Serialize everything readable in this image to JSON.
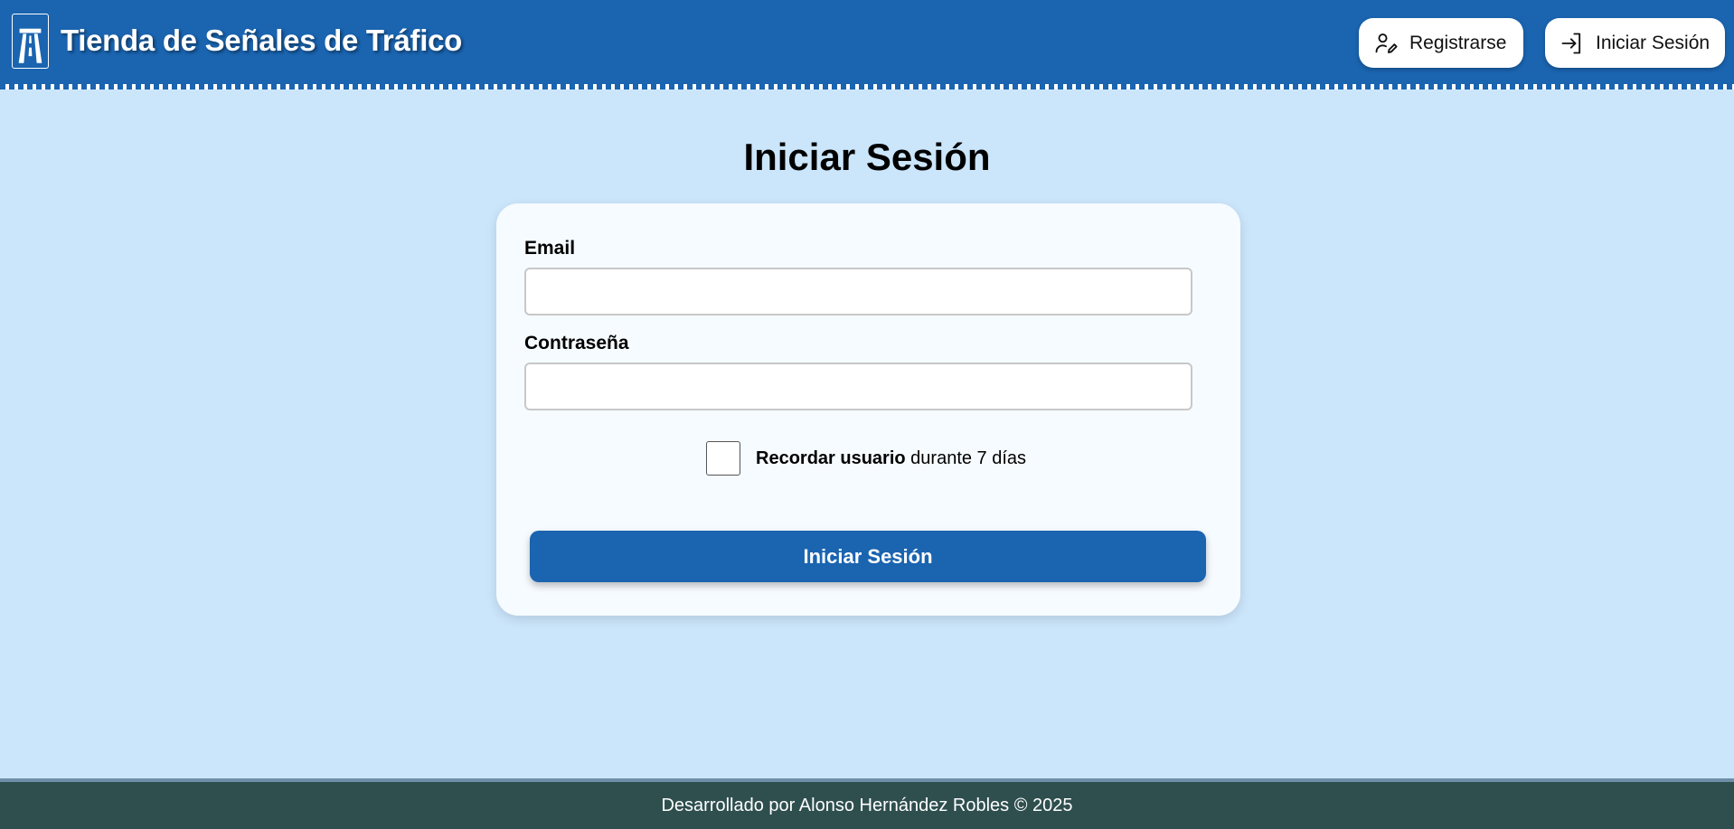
{
  "header": {
    "logo_icon": "motorway-sign-icon",
    "title": "Tienda de Señales de Tráfico",
    "register_label": "Registrarse",
    "register_icon": "user-edit-icon",
    "login_label": "Iniciar Sesión",
    "login_icon": "sign-in-icon"
  },
  "main": {
    "title": "Iniciar Sesión",
    "form": {
      "email_label": "Email",
      "email_value": "",
      "email_placeholder": "",
      "password_label": "Contraseña",
      "password_value": "",
      "password_placeholder": "",
      "remember_bold": "Recordar usuario",
      "remember_rest": " durante 7 días",
      "remember_checked": false,
      "submit_label": "Iniciar Sesión"
    }
  },
  "footer": {
    "text": "Desarrollado por Alonso Hernández Robles © 2025"
  },
  "colors": {
    "brand_blue": "#1a64b0",
    "page_background": "#cbe5fb",
    "card_background": "#f6fbff",
    "footer_background": "#2f4f4f"
  }
}
